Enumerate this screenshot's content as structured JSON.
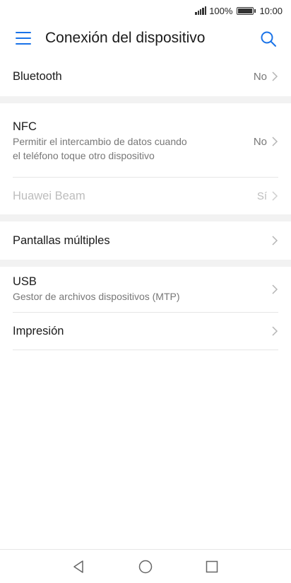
{
  "status_bar": {
    "battery_level": "100%",
    "time": "10:00",
    "icons": [
      "signal-icon",
      "battery-icon"
    ]
  },
  "app_bar": {
    "title": "Conexión del dispositivo",
    "icons": [
      "menu-icon",
      "search-icon"
    ],
    "accent_color": "#1a73e8"
  },
  "items": {
    "bluetooth": {
      "title": "Bluetooth",
      "value": "No"
    },
    "nfc": {
      "title": "NFC",
      "subtitle": "Permitir el intercambio de datos cuando el teléfono toque otro dispositivo",
      "value": "No"
    },
    "huawei_beam": {
      "title": "Huawei Beam",
      "value": "Sí"
    },
    "multi_screen": {
      "title": "Pantallas múltiples"
    },
    "usb": {
      "title": "USB",
      "subtitle": "Gestor de archivos dispositivos (MTP)"
    },
    "print": {
      "title": "Impresión"
    }
  },
  "nav_bar": {
    "icons": [
      "back-icon",
      "home-icon",
      "recents-icon"
    ]
  }
}
